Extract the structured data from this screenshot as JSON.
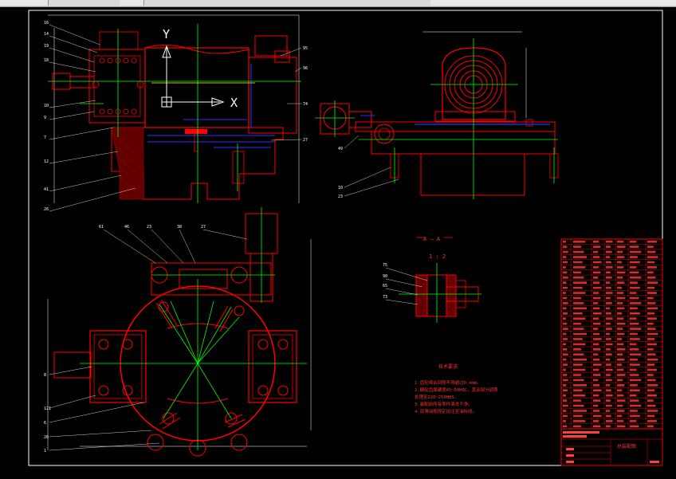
{
  "window": {
    "tabs": [
      "",
      "",
      ""
    ]
  },
  "axis": {
    "y_label": "Y",
    "x_label": "X"
  },
  "section": {
    "title": "A — A",
    "scale": "1 : 2"
  },
  "notes": {
    "title": "技术要求",
    "lines": [
      "1.齿轮啮合间隙不得超过0.4mm。",
      "2.蜗轮齿面硬度45~50HRC，其余部分调质",
      "处理至220~250HBS。",
      "3.装配前所有零件清洗干净。",
      "4.润滑油按规定加注至油标线。"
    ]
  },
  "title_block": {
    "drawing_name": "总装配图"
  },
  "colors": {
    "background": "#000000",
    "outline": "#ff0000",
    "center": "#00ff00",
    "dimension": "#ffffff",
    "hidden": "#2f2fff",
    "hatch": "#b00000"
  }
}
